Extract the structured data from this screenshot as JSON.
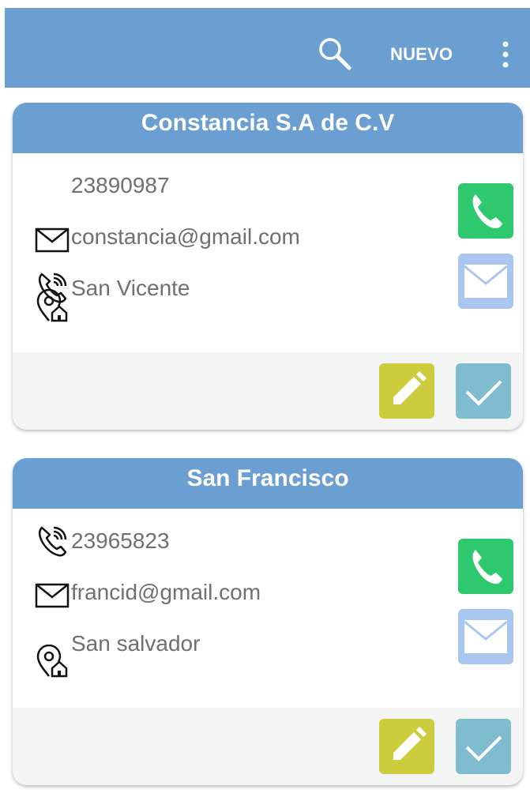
{
  "appbar": {
    "new_label": "NUEVO",
    "search_icon": "search-icon",
    "menu_icon": "overflow-menu-icon"
  },
  "contacts": [
    {
      "name": "Constancia S.A de C.V",
      "phone": "23890987",
      "email": "constancia@gmail.com",
      "address": "San Vicente"
    },
    {
      "name": "San Francisco",
      "phone": "23965823",
      "email": "francid@gmail.com",
      "address": "San salvador"
    }
  ],
  "colors": {
    "primary": "#6b9fd1",
    "call": "#2ec86e",
    "mail": "#a9c7ee",
    "edit": "#cccc3c",
    "check": "#7fbcd0",
    "footer": "#f4f4f4"
  }
}
